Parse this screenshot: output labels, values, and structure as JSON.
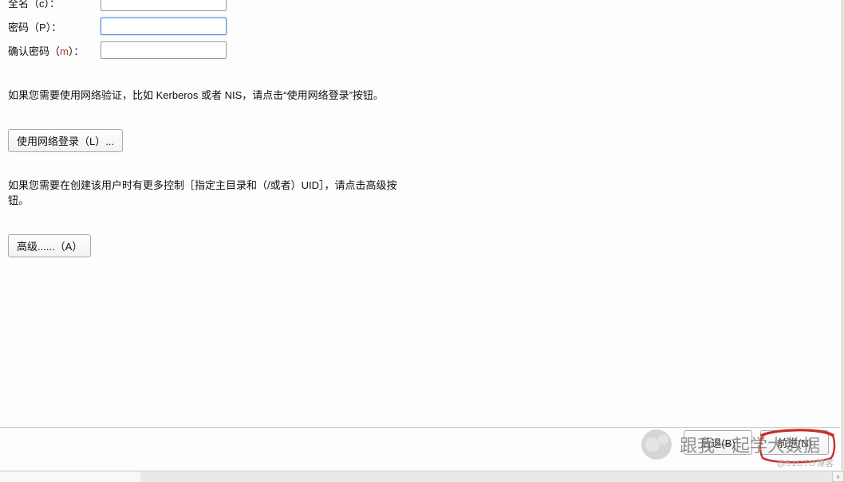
{
  "form": {
    "fullname": {
      "label_prefix": "全名（",
      "hotkey": "c",
      "label_suffix": "）：",
      "value": ""
    },
    "password": {
      "label_prefix": "密码（",
      "hotkey": "P",
      "label_suffix": "）：",
      "value": ""
    },
    "confirm": {
      "label_prefix": "确认密码（",
      "hotkey": "m",
      "label_suffix": "）：",
      "value": ""
    }
  },
  "help": {
    "network_auth": "如果您需要使用网络验证，比如 Kerberos 或者 NIS，请点击“使用网络登录”按钮。",
    "advanced": "如果您需要在创建该用户时有更多控制［指定主目录和（/或者）UID］，请点击高级按钮。"
  },
  "buttons": {
    "network_login": "使用网络登录（L）...",
    "advanced": "高级......（A）",
    "back": "后退(B)",
    "forward": "前进(N)"
  },
  "watermark": {
    "text": "跟我一起学大数据"
  },
  "attribution": "@51CTO博客",
  "colors": {
    "hotkey_m": "#9a4a2a",
    "highlight_stroke": "#c5302b"
  }
}
